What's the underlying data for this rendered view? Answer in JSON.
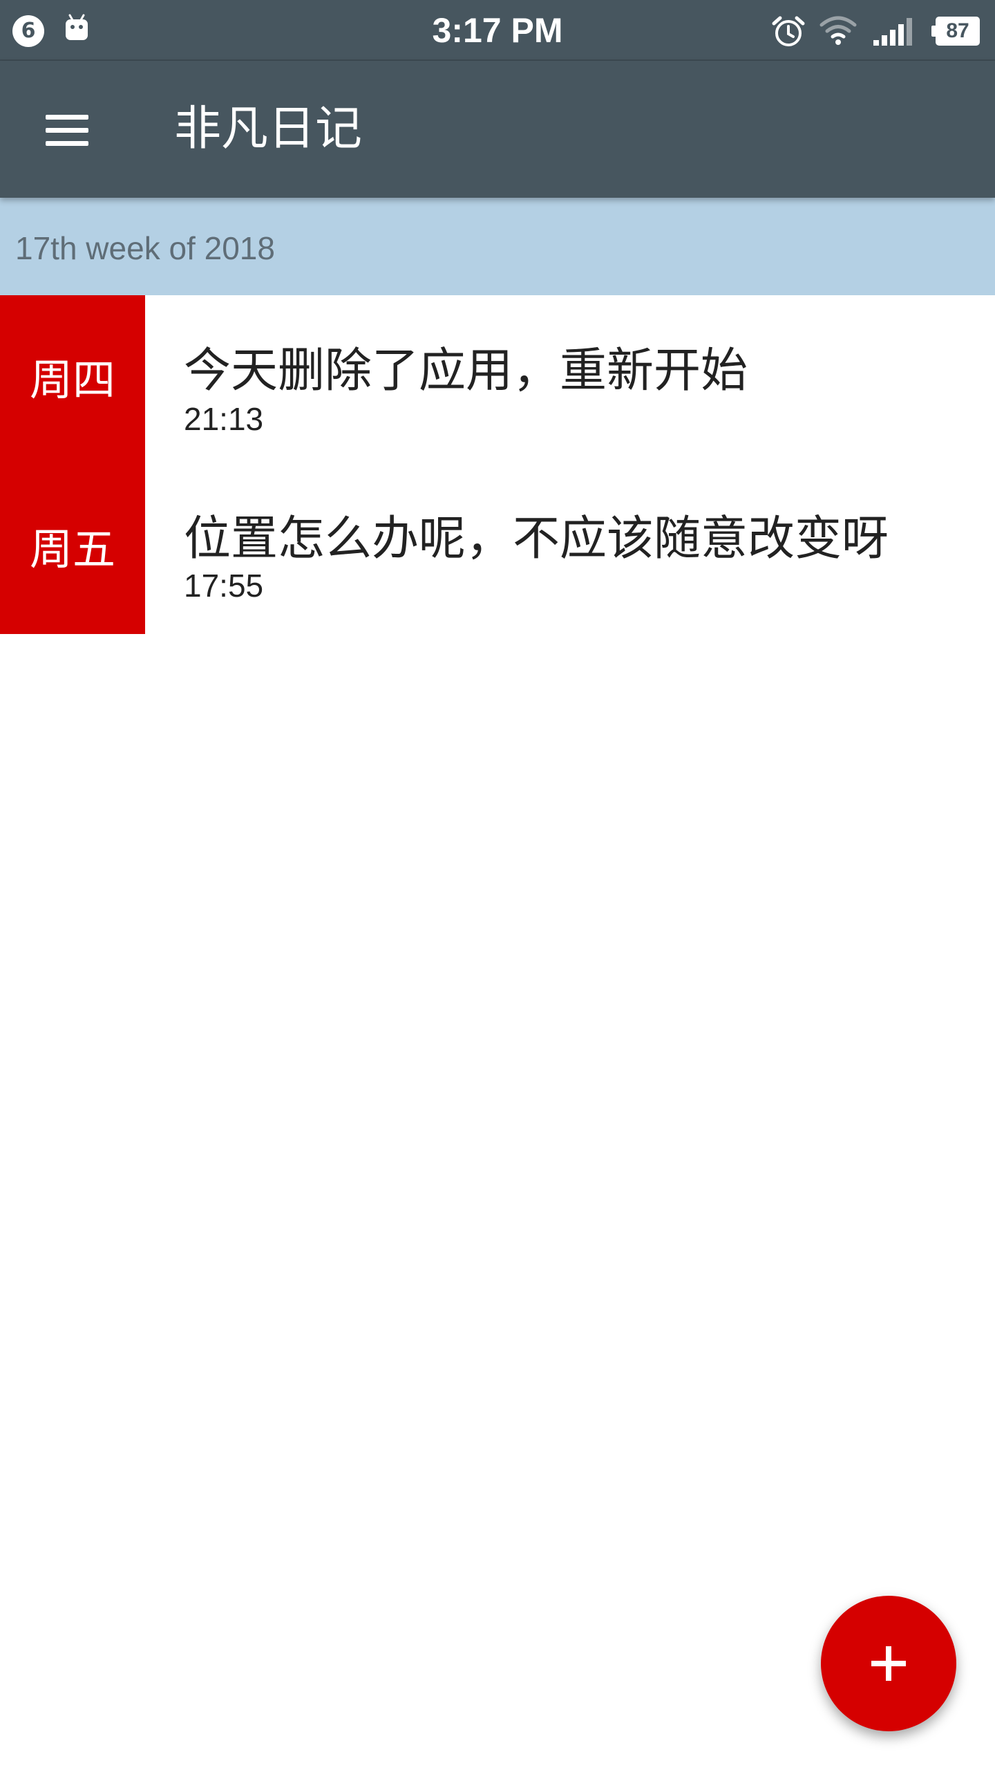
{
  "status_bar": {
    "notification_count": "6",
    "time": "3:17 PM",
    "battery_level": "87",
    "icons": [
      "android-icon",
      "alarm-icon",
      "wifi-icon",
      "signal-icon",
      "battery-icon"
    ]
  },
  "app_bar": {
    "title": "非凡日记",
    "menu_icon": "hamburger-menu-icon"
  },
  "week_header": {
    "label": "17th week of 2018"
  },
  "entries": [
    {
      "day": "周四",
      "title": "今天删除了应用，重新开始",
      "time": "21:13"
    },
    {
      "day": "周五",
      "title": "位置怎么办呢，不应该随意改变呀",
      "time": "17:55"
    }
  ],
  "fab": {
    "icon": "plus-icon"
  },
  "colors": {
    "toolbar": "#47565f",
    "week_header_bg": "#b4d0e4",
    "accent_red": "#d50000"
  }
}
